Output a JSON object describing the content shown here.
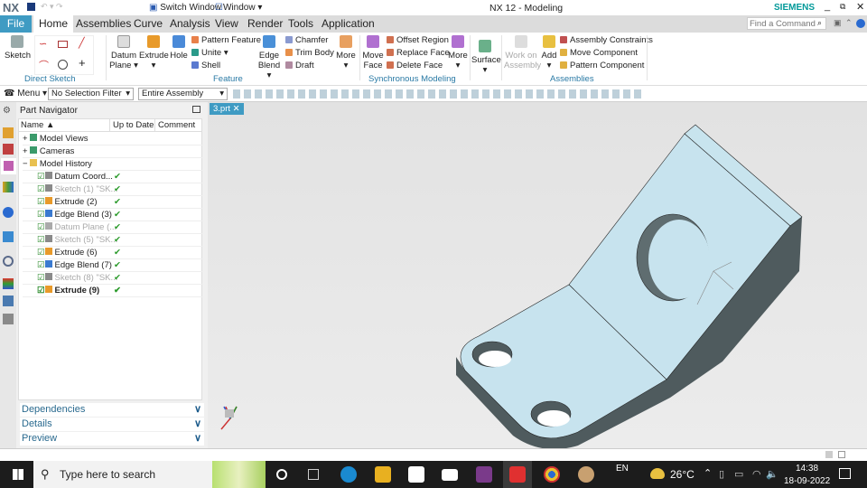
{
  "titlebar": {
    "logo": "NX",
    "switch_window": "Switch Window",
    "window": "Window",
    "title": "NX 12 - Modeling",
    "brand": "SIEMENS"
  },
  "menu_tabs": [
    "File",
    "Home",
    "Assemblies",
    "Curve",
    "Analysis",
    "View",
    "Render",
    "Tools",
    "Application"
  ],
  "search": {
    "placeholder": "Find a Command"
  },
  "ribbon": {
    "sketch": "Sketch",
    "direct_sketch": "Direct Sketch",
    "datum_plane": "Datum Plane",
    "extrude": "Extrude",
    "hole": "Hole",
    "pattern_feature": "Pattern Feature",
    "unite": "Unite",
    "shell": "Shell",
    "edge_blend": "Edge Blend",
    "chamfer": "Chamfer",
    "trim_body": "Trim Body",
    "draft": "Draft",
    "more": "More",
    "feature": "Feature",
    "move_face": "Move Face",
    "offset_region": "Offset Region",
    "replace_face": "Replace Face",
    "delete_face": "Delete Face",
    "more2": "More",
    "synchronous_modeling": "Synchronous Modeling",
    "surface": "Surface",
    "work_on_assembly": "Work on Assembly",
    "add": "Add",
    "assembly_constraints": "Assembly Constraints",
    "move_component": "Move Component",
    "pattern_component": "Pattern Component",
    "assemblies": "Assemblies"
  },
  "toolbar": {
    "menu": "Menu",
    "selection_filter": "No Selection Filter",
    "scope": "Entire Assembly"
  },
  "navigator": {
    "title": "Part Navigator",
    "columns": [
      "Name",
      "Up to Date",
      "Comment"
    ],
    "roots": [
      {
        "label": "Model Views",
        "prefix": "+"
      },
      {
        "label": "Cameras",
        "prefix": "+"
      },
      {
        "label": "Model History",
        "prefix": "−"
      }
    ],
    "items": [
      {
        "label": "Datum Coord...",
        "dim": false,
        "bold": false,
        "color": "#8a8a8a"
      },
      {
        "label": "Sketch (1) \"SK...",
        "dim": true,
        "bold": false,
        "color": "#8a8a8a"
      },
      {
        "label": "Extrude (2)",
        "dim": false,
        "bold": false,
        "color": "#e89a2a"
      },
      {
        "label": "Edge Blend (3)",
        "dim": false,
        "bold": false,
        "color": "#3a7ad0"
      },
      {
        "label": "Datum Plane (...",
        "dim": true,
        "bold": false,
        "color": "#aaaaaa"
      },
      {
        "label": "Sketch (5) \"SK...",
        "dim": true,
        "bold": false,
        "color": "#8a8a8a"
      },
      {
        "label": "Extrude (6)",
        "dim": false,
        "bold": false,
        "color": "#e89a2a"
      },
      {
        "label": "Edge Blend (7)",
        "dim": false,
        "bold": false,
        "color": "#3a7ad0"
      },
      {
        "label": "Sketch (8) \"SK...",
        "dim": true,
        "bold": false,
        "color": "#8a8a8a"
      },
      {
        "label": "Extrude (9)",
        "dim": false,
        "bold": true,
        "color": "#e89a2a"
      }
    ],
    "panels": [
      "Dependencies",
      "Details",
      "Preview"
    ]
  },
  "viewport": {
    "tab": "3.prt"
  },
  "taskbar": {
    "search": "Type here to search",
    "lang": "EN",
    "weather": "26°C",
    "time": "14:38",
    "date": "18-09-2022"
  }
}
